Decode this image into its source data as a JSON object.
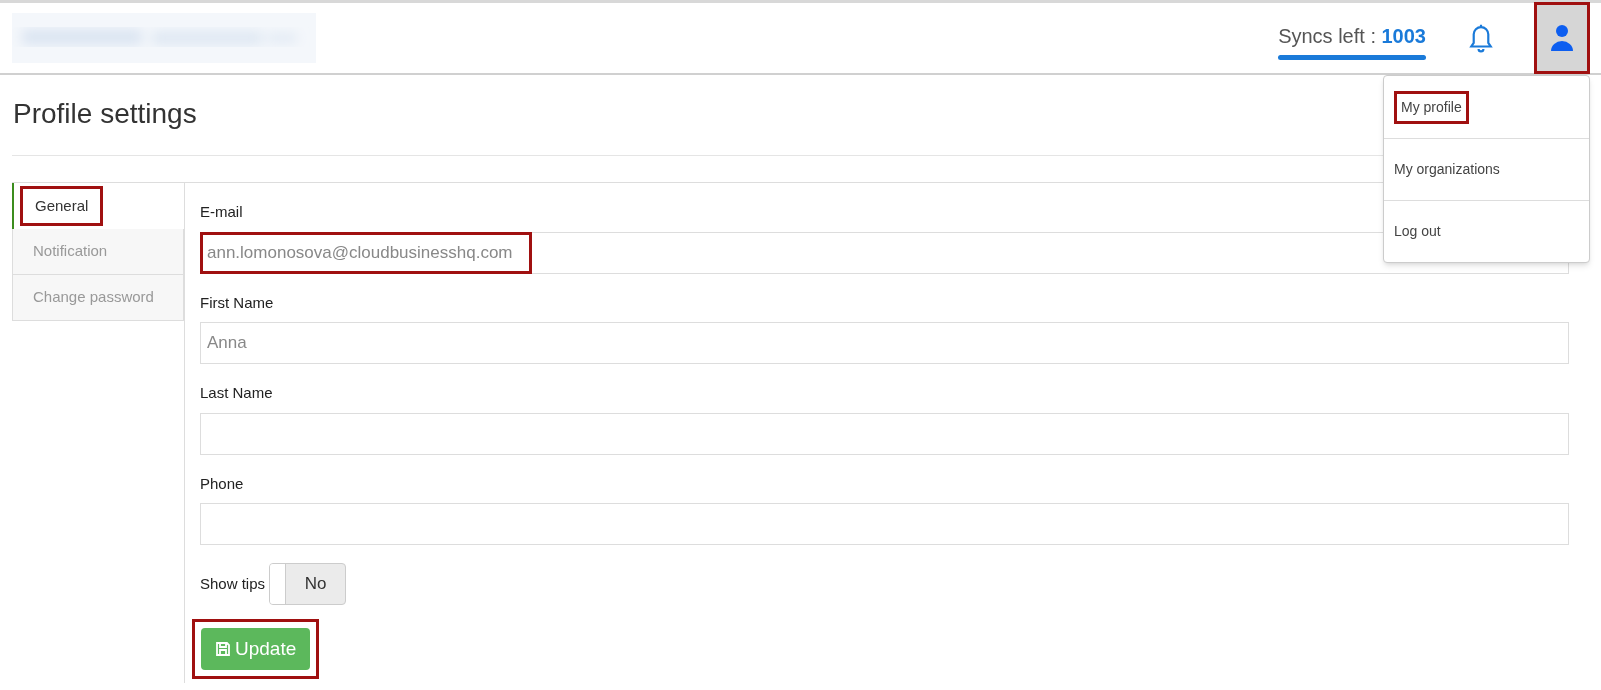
{
  "header": {
    "syncs": {
      "label": "Syncs left : ",
      "count": "1003"
    },
    "user_button": {
      "highlighted": true
    }
  },
  "user_menu": {
    "items": [
      {
        "label": "My profile",
        "highlighted": true
      },
      {
        "label": "My organizations",
        "highlighted": false
      },
      {
        "label": "Log out",
        "highlighted": false
      }
    ]
  },
  "title": "Profile settings",
  "tabs": [
    {
      "label": "General",
      "selected": true,
      "highlighted": true
    },
    {
      "label": "Notification",
      "selected": false,
      "highlighted": false
    },
    {
      "label": "Change password",
      "selected": false,
      "highlighted": false
    }
  ],
  "fields": [
    {
      "label": "E-mail",
      "value": "ann.lomonosova@cloudbusinesshq.com",
      "highlighted": true
    },
    {
      "label": "First Name",
      "value": "Anna",
      "highlighted": false
    },
    {
      "label": "Last Name",
      "highlighted": false
    },
    {
      "label": "Phone",
      "highlighted": false
    }
  ],
  "show_tips": {
    "label": "Show tips",
    "on": false,
    "state_text": "No"
  },
  "update_button": {
    "label": "Update",
    "highlighted": true
  }
}
